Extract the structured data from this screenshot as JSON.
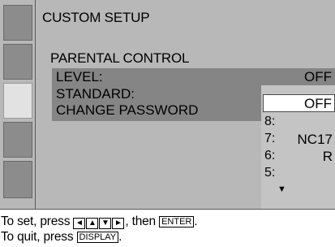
{
  "menu": {
    "title": "CUSTOM SETUP",
    "subtitle": "PARENTAL CONTROL",
    "level_label": "LEVEL:",
    "level_value": "OFF",
    "standard_label": "STANDARD:",
    "change_password_label": "CHANGE PASSWORD"
  },
  "dropdown": {
    "selected": "OFF",
    "items": [
      {
        "num": "8:",
        "label": ""
      },
      {
        "num": "7:",
        "label": "NC17"
      },
      {
        "num": "6:",
        "label": "R"
      },
      {
        "num": "5:",
        "label": ""
      }
    ],
    "more_arrow": "▼"
  },
  "instructions": {
    "line1_prefix": "To set, press",
    "arrow_keys": [
      "◄",
      "▲",
      "▼",
      "►"
    ],
    "line1_mid": ", then",
    "enter_key": "ENTER",
    "line1_suffix": ".",
    "line2_prefix": "To quit, press",
    "display_key": "DISPLAY",
    "line2_suffix": "."
  }
}
